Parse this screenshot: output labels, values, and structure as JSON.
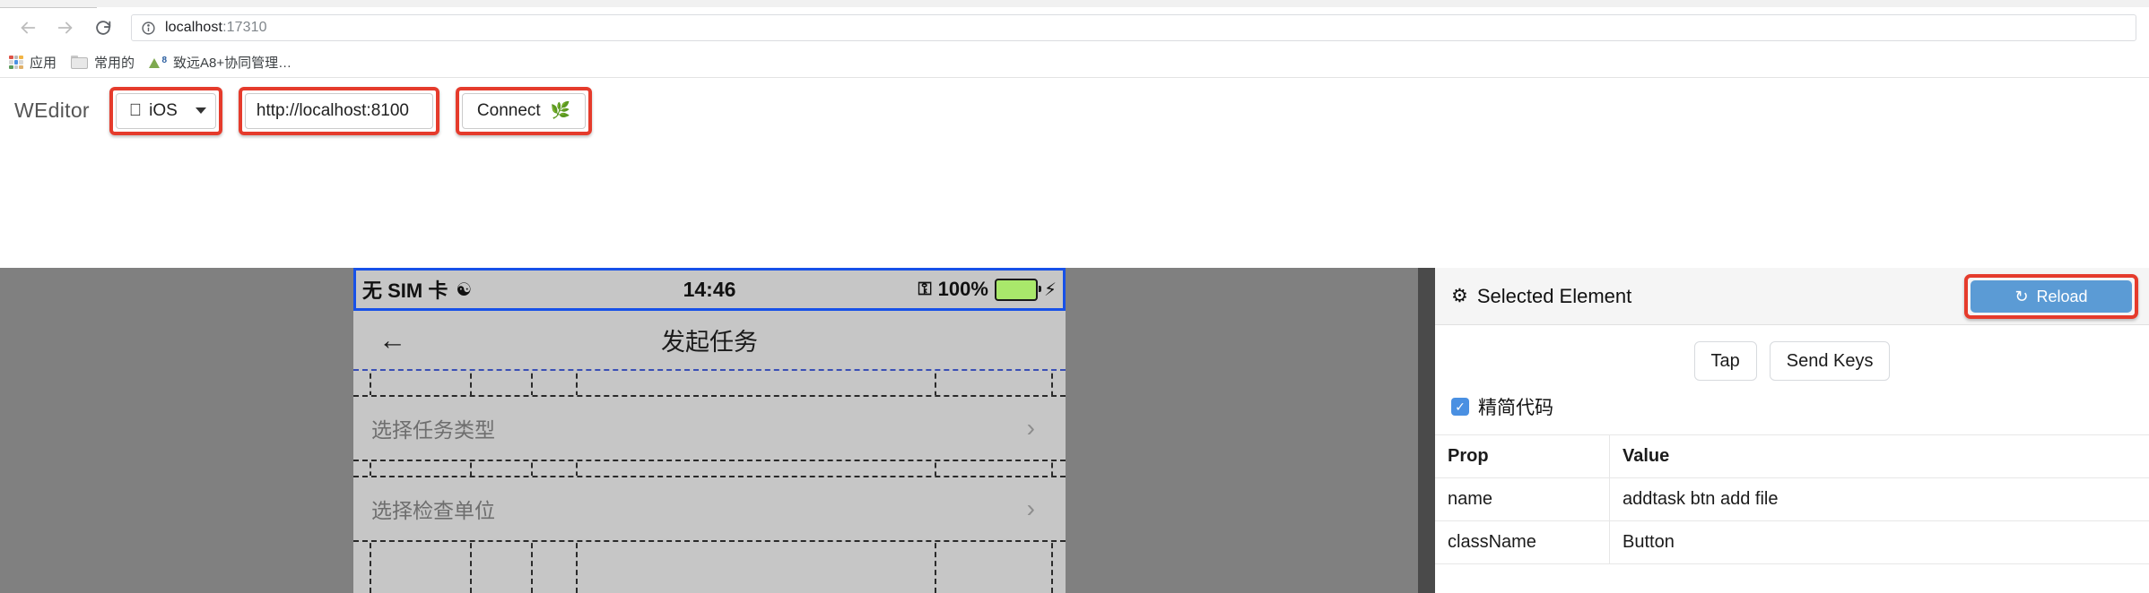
{
  "browser": {
    "back_icon": "arrow-left",
    "forward_icon": "arrow-right",
    "reload_icon": "reload",
    "info_icon": "info-circle",
    "url_host": "localhost",
    "url_port": ":17310",
    "bookmarks": [
      {
        "label": "应用",
        "icon": "apps-grid-icon"
      },
      {
        "label": "常用的",
        "icon": "folder-icon"
      },
      {
        "label": "致远A8+协同管理…",
        "icon": "a8-site-icon"
      }
    ]
  },
  "weditor": {
    "brand": "WEditor",
    "platform_select": {
      "value": "iOS",
      "icon": "apple-icon"
    },
    "url_input": {
      "value": "http://localhost:8100",
      "placeholder": "http://localhost:8100"
    },
    "connect_button": {
      "label": "Connect",
      "icon": "seedling-icon"
    },
    "accent_red": "#e53b2c"
  },
  "device": {
    "status_bar": {
      "carrier": "无 SIM 卡",
      "wifi_icon": "wifi-icon",
      "time": "14:46",
      "rotation_lock_icon": "rotation-lock-icon",
      "battery_percent": "100%",
      "battery_icon": "battery-icon",
      "charging_icon": "lightning-bolt-icon",
      "selection_color": "#1751e8"
    },
    "nav": {
      "back_icon": "back-arrow-icon",
      "title": "发起任务"
    },
    "rows": [
      {
        "label": "选择任务类型",
        "chevron": "›"
      },
      {
        "label": "选择检查单位",
        "chevron": "›"
      }
    ]
  },
  "panel": {
    "title": "Selected Element",
    "title_icon": "gear-icon",
    "reload_button": {
      "label": "Reload",
      "icon": "refresh-icon",
      "color": "#5b9bd5"
    },
    "actions": [
      {
        "label": "Tap"
      },
      {
        "label": "Send Keys"
      }
    ],
    "checkbox": {
      "label": "精简代码",
      "checked": true,
      "mark": "✓"
    },
    "table": {
      "headers": [
        "Prop",
        "Value"
      ],
      "rows": [
        {
          "prop": "name",
          "value": "addtask btn add file"
        },
        {
          "prop": "className",
          "value": "Button"
        }
      ]
    }
  }
}
